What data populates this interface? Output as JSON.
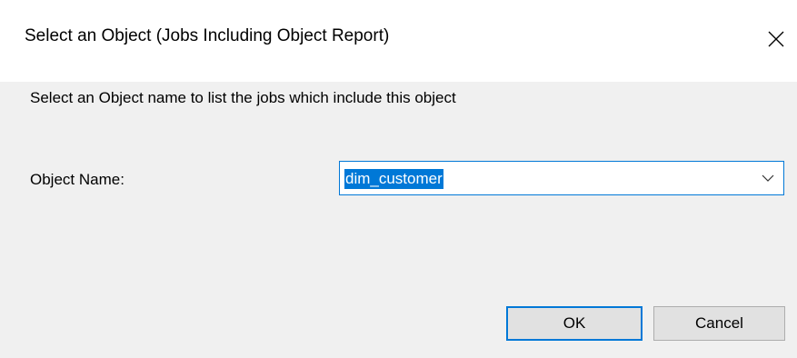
{
  "dialog": {
    "title": "Select an Object (Jobs Including Object Report)",
    "close_icon": "close-icon",
    "instruction": "Select an Object name to list the jobs which include this object",
    "object_name_label": "Object Name:",
    "object_name_value": "dim_customer",
    "dropdown_icon": "chevron-down-icon",
    "ok_label": "OK",
    "cancel_label": "Cancel"
  },
  "colors": {
    "accent": "#0078d7",
    "dialog_background": "#f0f0f0",
    "titlebar_background": "#ffffff",
    "button_background": "#e1e1e1"
  }
}
